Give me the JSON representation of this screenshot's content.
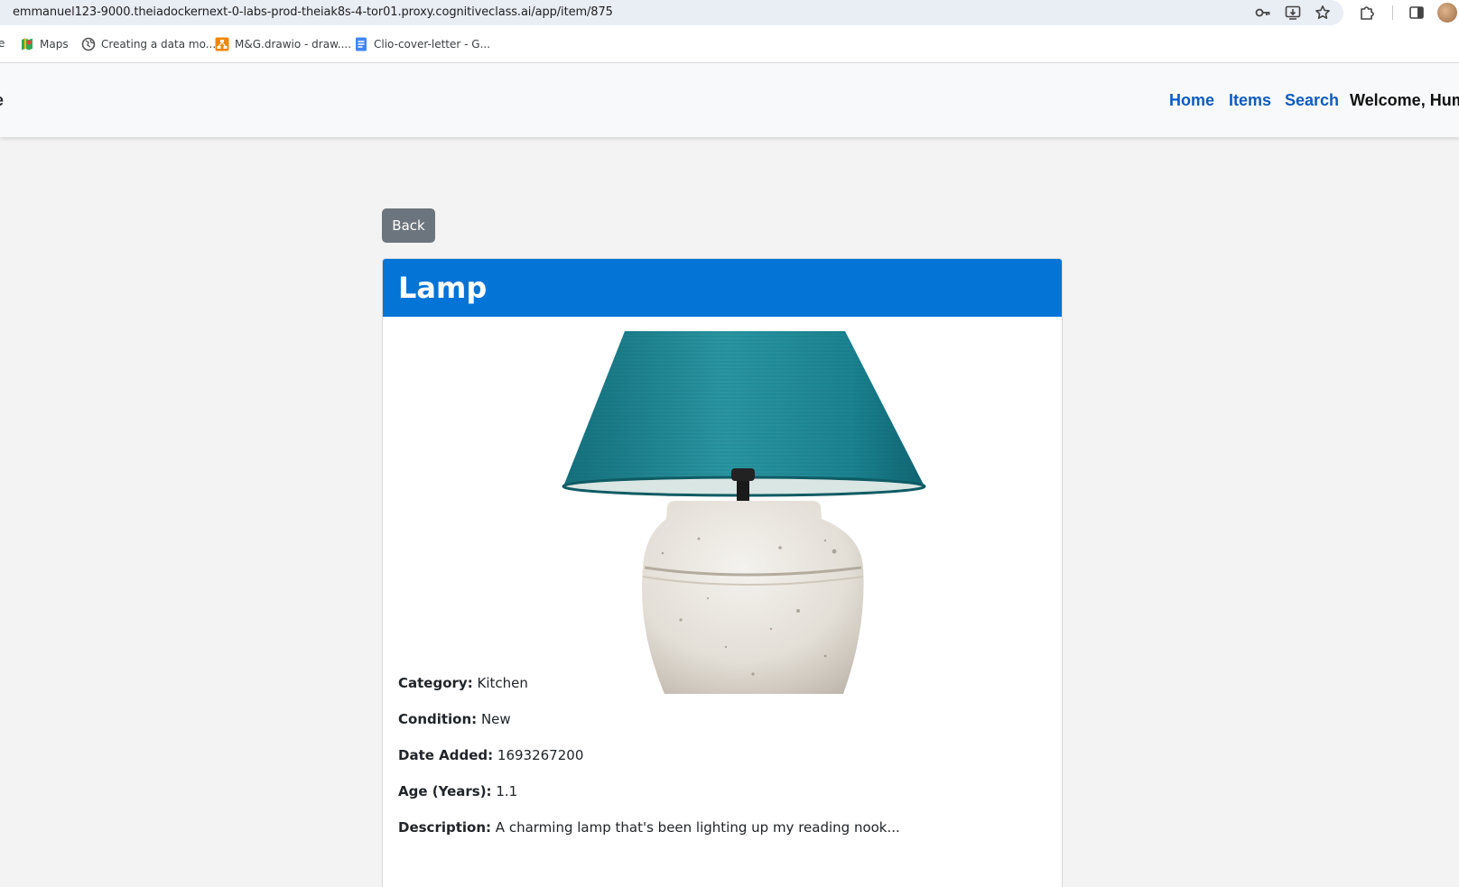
{
  "browser": {
    "url": "emmanuel123-9000.theiadockernext-0-labs-prod-theiak8s-4-tor01.proxy.cognitiveclass.ai/app/item/875",
    "bookmarks": [
      {
        "label": "e",
        "icon": "page-icon"
      },
      {
        "label": "Maps",
        "icon": "maps-icon"
      },
      {
        "label": "Creating a data mo...",
        "icon": "globe-icon"
      },
      {
        "label": "M&G.drawio - draw....",
        "icon": "drawio-icon"
      },
      {
        "label": "Clio-cover-letter - G...",
        "icon": "docs-icon"
      }
    ],
    "colors": {
      "url_bar": "#e9edf4"
    }
  },
  "navbar": {
    "brand_fragment": "e",
    "links": [
      "Home",
      "Items",
      "Search"
    ],
    "welcome": "Welcome, Hum",
    "colors": {
      "link": "#0d5bbf",
      "background": "#f8f9fa"
    }
  },
  "page": {
    "back_label": "Back",
    "item": {
      "title": "Lamp",
      "image": "lamp-image",
      "details": [
        {
          "label": "Category:",
          "value": "Kitchen"
        },
        {
          "label": "Condition:",
          "value": "New"
        },
        {
          "label": "Date Added:",
          "value": "1693267200"
        },
        {
          "label": "Age (Years):",
          "value": "1.1"
        },
        {
          "label": "Description:",
          "value": "A charming lamp that's been lighting up my reading nook..."
        }
      ]
    },
    "colors": {
      "header": "#0474d7",
      "back_button": "#6c757d",
      "background": "#f3f3f3"
    }
  }
}
